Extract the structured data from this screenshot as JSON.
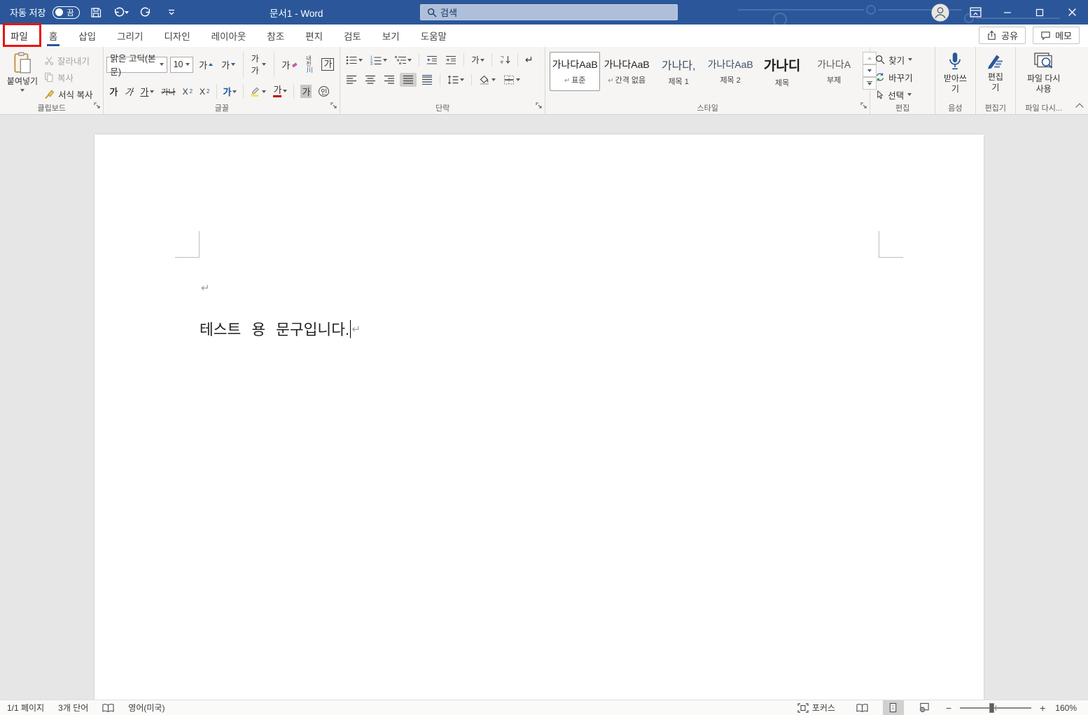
{
  "colors": {
    "titlebar": "#2b579a",
    "accent": "#2b579a",
    "annotation_red": "#e8140f",
    "ribbon_bg": "#f6f5f3"
  },
  "titlebar": {
    "autosave_label": "자동 저장",
    "autosave_state": "끔",
    "doc_title": "문서1  -  Word",
    "search_placeholder": "검색"
  },
  "tabs": {
    "file": "파일",
    "items": [
      "홈",
      "삽입",
      "그리기",
      "디자인",
      "레이아웃",
      "참조",
      "편지",
      "검토",
      "보기",
      "도움말"
    ],
    "active": "홈",
    "share": "공유",
    "comments": "메모"
  },
  "ribbon": {
    "clipboard": {
      "label": "클립보드",
      "paste": "붙여넣기",
      "cut": "잘라내기",
      "copy": "복사",
      "format_painter": "서식 복사"
    },
    "font": {
      "label": "글꼴",
      "family": "맑은 고딕(본문)",
      "size": "10",
      "ga": "가",
      "gaga": "가가",
      "phonetic_top": "내천",
      "phonetic_bottom": "川",
      "strike": "가나",
      "script_base": "X",
      "sub_script": "2",
      "sup_script": "2",
      "enclose": "인"
    },
    "paragraph": {
      "label": "단락",
      "asian": "가",
      "sort_top": "ㄱ",
      "sort_bottom": "ㅎ",
      "pilcrow": "↵"
    },
    "styles": {
      "label": "스타일",
      "items": [
        {
          "preview": "가나다AaB",
          "mark": "↵",
          "name": "표준"
        },
        {
          "preview": "가나다AaB",
          "mark": "↵",
          "name": "간격 없음"
        },
        {
          "preview": "가나다,",
          "mark": "",
          "name": "제목 1"
        },
        {
          "preview": "가나다AaB",
          "mark": "",
          "name": "제목 2"
        },
        {
          "preview": "가나디",
          "mark": "",
          "name": "제목"
        },
        {
          "preview": "가나다A",
          "mark": "",
          "name": "부제"
        }
      ]
    },
    "editing": {
      "label": "편집",
      "find": "찾기",
      "replace": "바꾸기",
      "select": "선택"
    },
    "voice": {
      "label": "음성",
      "dictate": "받아쓰기"
    },
    "editor": {
      "label": "편집기",
      "button": "편집기"
    },
    "reuse": {
      "label": "파일 다시...",
      "button": "파일 다시 사용"
    }
  },
  "document": {
    "text": "테스트 용 문구입니다.",
    "pilcrow": "↵"
  },
  "statusbar": {
    "page": "1/1 페이지",
    "words": "3개 단어",
    "language": "영어(미국)",
    "focus": "포커스",
    "zoom_level": "160%"
  }
}
